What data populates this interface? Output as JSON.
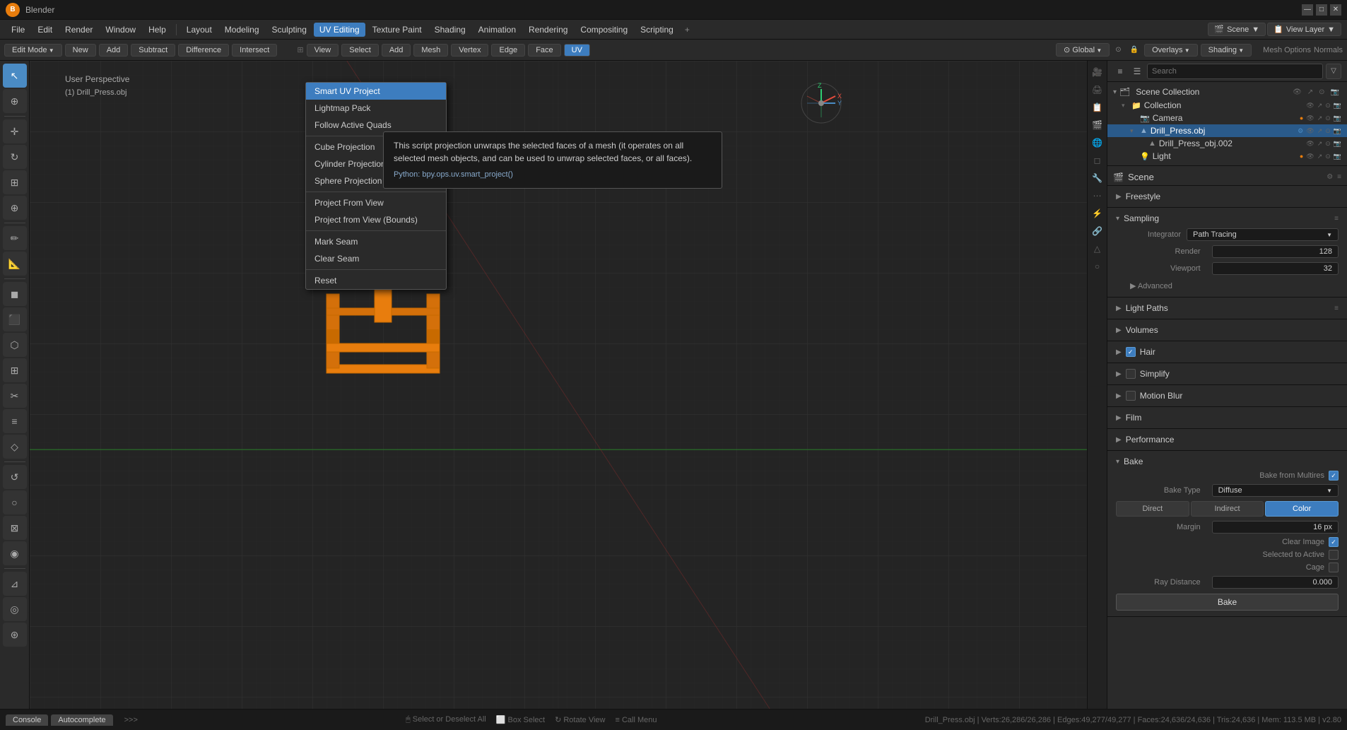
{
  "window": {
    "title": "Blender"
  },
  "titlebar": {
    "logo": "B",
    "title": "Blender",
    "minimize": "—",
    "maximize": "□",
    "close": "✕"
  },
  "menubar": {
    "items": [
      "File",
      "Edit",
      "Render",
      "Window",
      "Help"
    ],
    "workspace_tabs": [
      "Layout",
      "Modeling",
      "Sculpting",
      "UV Editing",
      "Texture Paint",
      "Shading",
      "Animation",
      "Rendering",
      "Compositing",
      "Scripting"
    ],
    "active_workspace": "UV Editing",
    "plus": "+"
  },
  "toolbar2": {
    "mode_dropdown": "Edit Mode",
    "buttons": [
      "New",
      "Add",
      "Subtract",
      "Difference",
      "Intersect"
    ],
    "active_button": "",
    "view_menu": "View",
    "select_menu": "Select",
    "add_menu": "Add",
    "mesh_menu": "Mesh",
    "vertex_menu": "Vertex",
    "edge_menu": "Edge",
    "face_menu": "Face",
    "uv_menu": "UV",
    "global_dropdown": "Global",
    "overlay_btn": "Overlays",
    "shading_btn": "Shading"
  },
  "uv_dropdown": {
    "items": [
      {
        "label": "Smart UV Project",
        "selected": true
      },
      {
        "label": "Lightmap Pack",
        "selected": false
      },
      {
        "label": "Follow Active Quads",
        "selected": false
      },
      {
        "label": "Cube Projection",
        "selected": false
      },
      {
        "label": "Cylinder Projection",
        "selected": false
      },
      {
        "label": "Sphere Projection",
        "selected": false
      },
      {
        "divider": true
      },
      {
        "label": "Project From View",
        "selected": false
      },
      {
        "label": "Project from View (Bounds)",
        "selected": false
      },
      {
        "divider": true
      },
      {
        "label": "Mark Seam",
        "selected": false
      },
      {
        "label": "Clear Seam",
        "selected": false
      },
      {
        "divider": true
      },
      {
        "label": "Reset",
        "selected": false
      }
    ]
  },
  "tooltip": {
    "description": "This script projection unwraps the selected faces of a mesh (it operates on all selected mesh objects, and can be used to unwrap selected faces, or all faces).",
    "python": "Python: bpy.ops.uv.smart_project()"
  },
  "viewport": {
    "perspective_label": "User Perspective",
    "object_label": "(1) Drill_Press.obj"
  },
  "scene_collection": {
    "title": "Scene Collection",
    "items": [
      {
        "type": "collection",
        "label": "Collection",
        "indent": 1,
        "expanded": true
      },
      {
        "type": "object",
        "label": "Camera",
        "indent": 2,
        "icon": "📷"
      },
      {
        "type": "object",
        "label": "Drill_Press.obj",
        "indent": 2,
        "icon": "▲",
        "selected": true,
        "highlighted": true
      },
      {
        "type": "object",
        "label": "Drill_Press_obj.002",
        "indent": 3,
        "icon": "▲"
      },
      {
        "type": "object",
        "label": "Light",
        "indent": 2,
        "icon": "💡"
      }
    ]
  },
  "properties": {
    "scene_label": "Scene",
    "sections": [
      {
        "label": "Freestyle",
        "expanded": false
      },
      {
        "label": "Sampling",
        "expanded": true,
        "content": {
          "integrator_label": "Integrator",
          "integrator_value": "Path Tracing",
          "render_label": "Render",
          "render_value": "128",
          "viewport_label": "Viewport",
          "viewport_value": "32",
          "advanced_label": "Advanced"
        }
      },
      {
        "label": "Light Paths",
        "expanded": false
      },
      {
        "label": "Volumes",
        "expanded": false
      },
      {
        "label": "Hair",
        "expanded": false,
        "checkbox": true,
        "checked": true
      },
      {
        "label": "Simplify",
        "expanded": false,
        "checkbox": true,
        "checked": false
      },
      {
        "label": "Motion Blur",
        "expanded": false,
        "checkbox": true,
        "checked": false
      },
      {
        "label": "Film",
        "expanded": false
      },
      {
        "label": "Performance",
        "expanded": false
      },
      {
        "label": "Bake",
        "expanded": true,
        "content": {
          "bake_from_multires_label": "Bake from Multires",
          "bake_from_multires_checked": true,
          "bake_type_label": "Bake Type",
          "bake_type_value": "Diffuse",
          "bake_modes": [
            "Direct",
            "Indirect",
            "Color"
          ],
          "active_mode": "Color",
          "margin_label": "Margin",
          "margin_value": "16 px",
          "clear_image_label": "Clear Image",
          "clear_image_checked": true,
          "selected_to_active_label": "Selected to Active",
          "cage_label": "Cage",
          "ray_distance_label": "Ray Distance",
          "ray_distance_value": "0.000",
          "bake_btn": "Bake"
        }
      }
    ]
  },
  "header_right": {
    "mesh_options": "Mesh Options",
    "normals": "Normals"
  },
  "bottom": {
    "tabs": [
      "Console",
      "Autocomplete"
    ],
    "active_tab": "Autocomplete",
    "arrows": ">>>",
    "status": "Select or Deselect All",
    "box_select": "Box Select",
    "rotate_view": "Rotate View",
    "call_menu": "Call Menu",
    "info": "Drill_Press.obj | Verts:26,286/26,286 | Edges:49,277/49,277 | Faces:24,636/24,636 | Tris:24,636 | Mem: 113.5 MB | v2.80"
  }
}
